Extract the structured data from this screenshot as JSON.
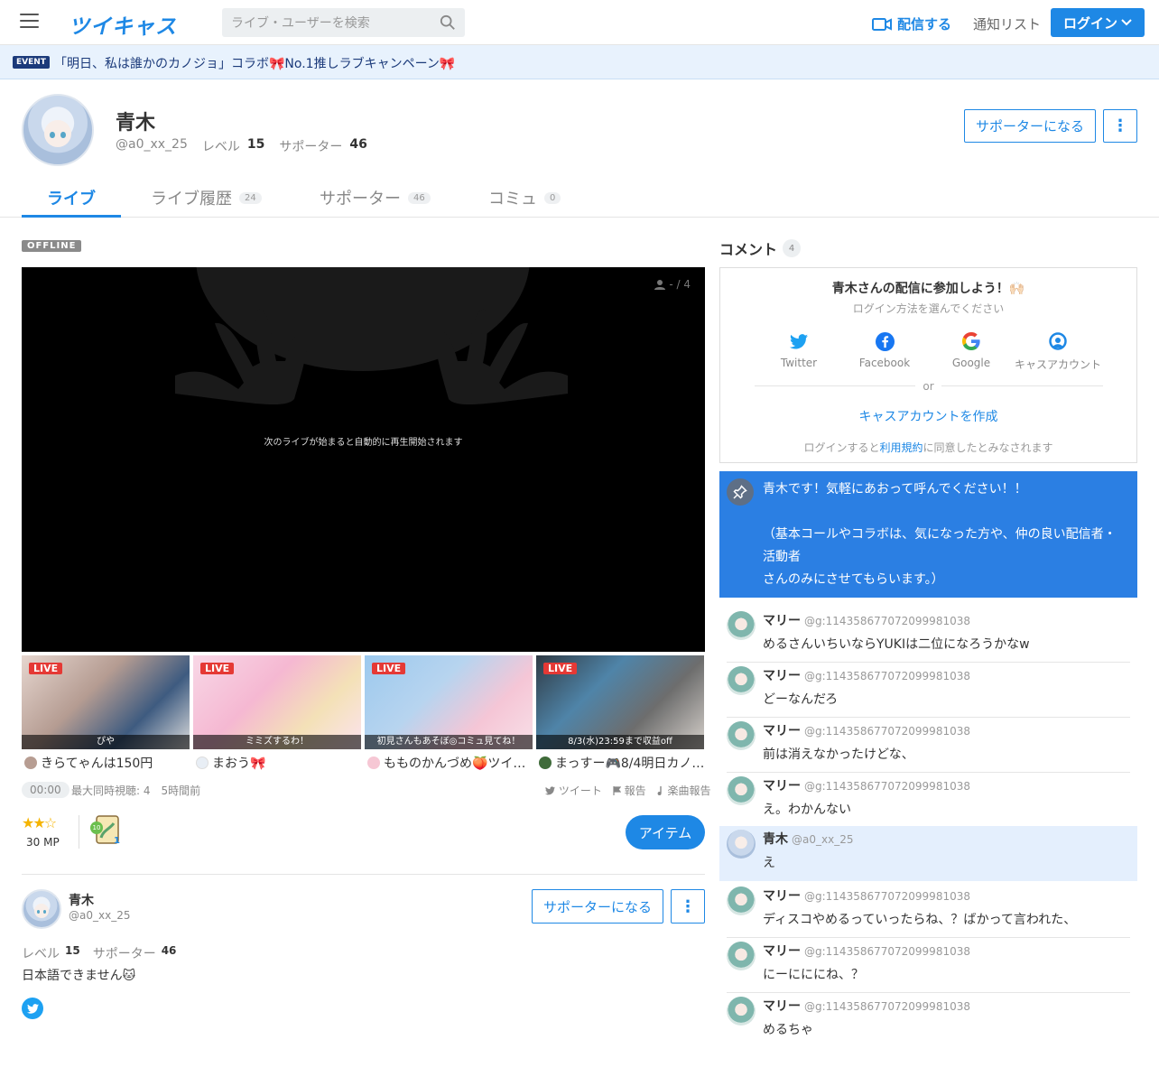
{
  "header": {
    "logo": "ツイキャス",
    "search_placeholder": "ライブ・ユーザーを検索",
    "broadcast_label": "配信する",
    "notify_label": "通知リスト",
    "login_label": "ログイン"
  },
  "event": {
    "tag": "EVENT",
    "text": "「明日、私は誰かのカノジョ」コラボ🎀No.1推しラブキャンペーン🎀"
  },
  "profile": {
    "name": "青木",
    "handle": "@a0_xx_25",
    "level_label": "レベル",
    "level": "15",
    "supporter_label": "サポーター",
    "supporters": "46",
    "support_button": "サポーターになる",
    "more_button": "⋮"
  },
  "tabs": [
    {
      "label": "ライブ",
      "count": ""
    },
    {
      "label": "ライブ履歴",
      "count": "24"
    },
    {
      "label": "サポーター",
      "count": "46"
    },
    {
      "label": "コミュ",
      "count": "0"
    }
  ],
  "player": {
    "status": "OFFLINE",
    "viewers": "- / 4",
    "message": "次のライブが始まると自動的に再生開始されます"
  },
  "live_list": [
    {
      "badge": "LIVE",
      "caption": "ぴや",
      "name": "きらてゃんは150円",
      "color": "#d9c8c0"
    },
    {
      "badge": "LIVE",
      "caption": "ミミズするわ！",
      "name": "まおう🎀",
      "color": "#f2c6d8"
    },
    {
      "badge": "LIVE",
      "caption": "初見さんもあそぼ◎コミュ見てね！",
      "name": "もものかんづめ🍑ツイ…",
      "color": "#9fc6e8"
    },
    {
      "badge": "LIVE",
      "caption": "8/3(水)23:59まで収益off",
      "name": "まっすー🎮8/4明日カノ…",
      "color": "#4a4f52"
    }
  ],
  "info": {
    "time": "00:00",
    "stats": "最大同時視聴: 4　5時間前",
    "tweet": "ツイート",
    "report": "報告",
    "music_report": "楽曲報告",
    "mp": "30 MP",
    "item_level": "10",
    "item_count": "1",
    "item_button": "アイテム"
  },
  "bio": {
    "name": "青木",
    "handle": "@a0_xx_25",
    "level_label": "レベル",
    "level": "15",
    "supporter_label": "サポーター",
    "supporters": "46",
    "text": "日本語できません🐱",
    "support_button": "サポーターになる"
  },
  "comments_panel": {
    "title": "コメント",
    "count": "4",
    "login_title": "青木さんの配信に参加しよう！🙌🏻",
    "login_sub": "ログイン方法を選んでください",
    "socials": [
      "Twitter",
      "Facebook",
      "Google",
      "キャスアカウント"
    ],
    "or": "or",
    "create": "キャスアカウントを作成",
    "terms_pre": "ログインすると",
    "terms_link": "利用規約",
    "terms_post": "に同意したとみなされます",
    "pinned": "青木です！気軽にあおって呼んでください！！\n\n（基本コールやコラボは、気になった方や、仲の良い配信者・活動者\nさんのみにさせてもらいます。）"
  },
  "comments": [
    {
      "name": "マリー",
      "id": "@g:114358677072099981038",
      "text": "めるさんいちいならYUKIは二位になろうかなw",
      "highlight": false
    },
    {
      "name": "マリー",
      "id": "@g:114358677072099981038",
      "text": "どーなんだろ",
      "highlight": false
    },
    {
      "name": "マリー",
      "id": "@g:114358677072099981038",
      "text": "前は消えなかったけどな、",
      "highlight": false
    },
    {
      "name": "マリー",
      "id": "@g:114358677072099981038",
      "text": "え。わかんない",
      "highlight": false
    },
    {
      "name": "青木",
      "id": "@a0_xx_25",
      "text": "え",
      "highlight": true
    },
    {
      "name": "マリー",
      "id": "@g:114358677072099981038",
      "text": "ディスコやめるっていったらね、？ばかって言われた、",
      "highlight": false
    },
    {
      "name": "マリー",
      "id": "@g:114358677072099981038",
      "text": "にーにににね、？",
      "highlight": false
    },
    {
      "name": "マリー",
      "id": "@g:114358677072099981038",
      "text": "めるちゃ",
      "highlight": false
    }
  ]
}
